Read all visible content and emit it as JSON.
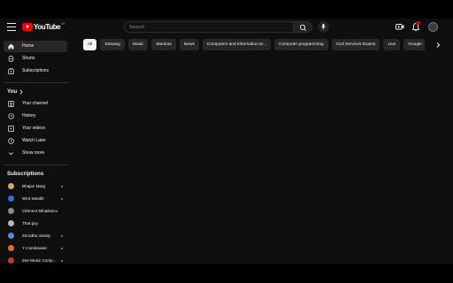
{
  "header": {
    "logo_text": "YouTube",
    "logo_country": "IN",
    "search_placeholder": "Search",
    "icons": [
      "menu-icon",
      "search-icon",
      "mic-icon",
      "create-icon",
      "bell-icon",
      "avatar"
    ],
    "notification_count": ""
  },
  "sidebar": {
    "main": [
      {
        "label": "Home",
        "icon": "home-icon",
        "active": true
      },
      {
        "label": "Shorts",
        "icon": "shorts-icon"
      },
      {
        "label": "Subscriptions",
        "icon": "subscriptions-icon"
      }
    ],
    "you": {
      "title": "You",
      "items": [
        {
          "label": "Your channel",
          "icon": "channel-icon"
        },
        {
          "label": "History",
          "icon": "history-icon"
        },
        {
          "label": "Your videos",
          "icon": "your-videos-icon"
        },
        {
          "label": "Watch Later",
          "icon": "watch-later-icon"
        },
        {
          "label": "Show more",
          "icon": "chevron-down-icon"
        }
      ]
    },
    "subscriptions": {
      "title": "Subscriptions",
      "items": [
        {
          "label": "Bhajan Marg",
          "color": "#d4a56a",
          "live": true
        },
        {
          "label": "Wint Wealth",
          "color": "#2f6fd6",
          "live": true
        },
        {
          "label": "Clément Mihailescu",
          "color": "#8a8a8a",
          "live": false
        },
        {
          "label": "That guy",
          "color": "#b9b9b9",
          "live": false
        },
        {
          "label": "Zerodha Varsity",
          "color": "#4a8ad8",
          "live": true
        },
        {
          "label": "Y Combinator",
          "color": "#f26522",
          "live": true
        },
        {
          "label": "Zee Music Comp...",
          "color": "#c0392b",
          "live": true
        }
      ]
    }
  },
  "chips": [
    {
      "label": "All",
      "active": true
    },
    {
      "label": "Satsang"
    },
    {
      "label": "Music"
    },
    {
      "label": "Mantras"
    },
    {
      "label": "News"
    },
    {
      "label": "Computers and information te..."
    },
    {
      "label": "Computer programming"
    },
    {
      "label": "Civil Services Exams"
    },
    {
      "label": "Live"
    },
    {
      "label": "Google"
    }
  ],
  "colors": {
    "background": "#0f0f0f",
    "chip": "#272727",
    "brand_red": "#ff0000",
    "live_dot": "#3ea6ff"
  }
}
